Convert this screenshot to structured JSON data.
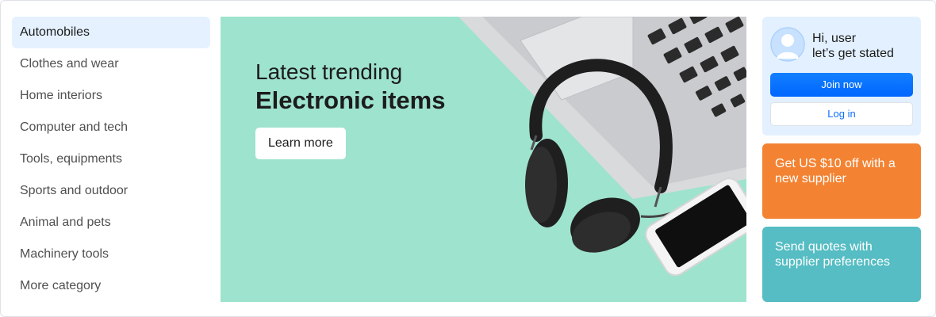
{
  "sidebar": {
    "items": [
      {
        "label": "Automobiles",
        "active": true
      },
      {
        "label": "Clothes and wear"
      },
      {
        "label": "Home interiors"
      },
      {
        "label": "Computer and tech"
      },
      {
        "label": "Tools, equipments"
      },
      {
        "label": "Sports and outdoor"
      },
      {
        "label": "Animal and pets"
      },
      {
        "label": "Machinery tools"
      },
      {
        "label": "More category"
      }
    ]
  },
  "banner": {
    "subtitle": "Latest trending",
    "title": "Electronic items",
    "button_label": "Learn more",
    "background": "#9ee3cd",
    "image_icon": "headphones-laptop-phone-image"
  },
  "user_card": {
    "greeting_line1": "Hi, user",
    "greeting_line2": "let’s get stated",
    "join_label": "Join now",
    "login_label": "Log in",
    "avatar_icon": "user-avatar-icon"
  },
  "promos": {
    "offer": {
      "text": "Get US $10 off with a new supplier",
      "color": "#f38332"
    },
    "quotes": {
      "text": "Send quotes with supplier preferences",
      "color": "#55bdc3"
    }
  },
  "colors": {
    "primary": "#0d6efd",
    "active_bg": "#e5f1ff"
  }
}
